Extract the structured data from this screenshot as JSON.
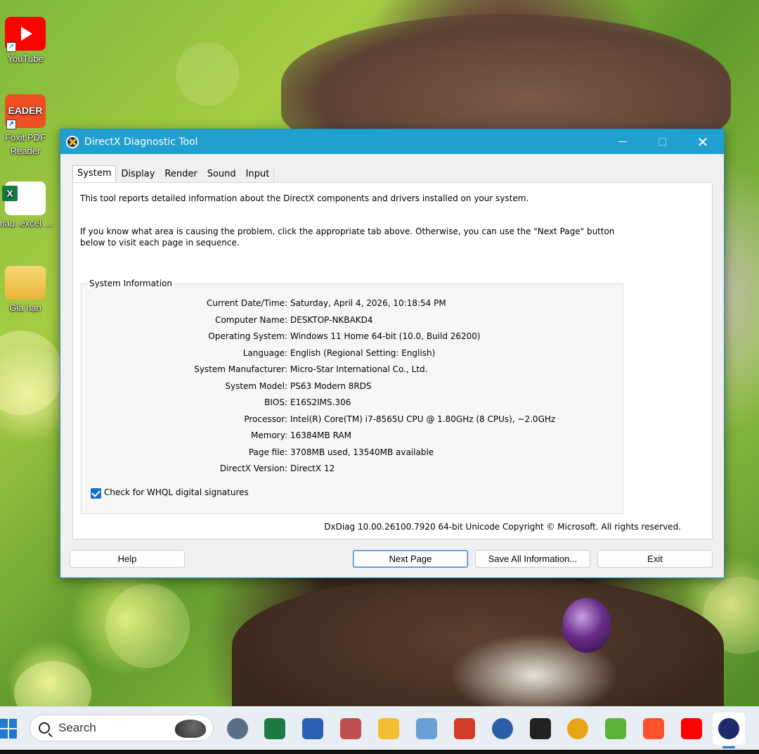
{
  "desktop": {
    "icons": [
      {
        "name": "youtube-shortcut",
        "label": "YouTube"
      },
      {
        "name": "foxit-shortcut",
        "label": "Foxit PDF Reader",
        "glyph_text": "EADER"
      },
      {
        "name": "excel-file",
        "label": "mau_excel_..."
      },
      {
        "name": "folder",
        "label": "Gia hạn"
      }
    ]
  },
  "window": {
    "title": "DirectX Diagnostic Tool",
    "controls": {
      "close": "✕"
    },
    "tabs": [
      "System",
      "Display",
      "Render",
      "Sound",
      "Input"
    ],
    "active_tab": "System",
    "intro1": "This tool reports detailed information about the DirectX components and drivers installed on your system.",
    "intro2": "If you know what area is causing the problem, click the appropriate tab above.  Otherwise, you can use the \"Next Page\" button below to visit each page in sequence.",
    "group_title": "System Information",
    "info": [
      {
        "label": "Current Date/Time:",
        "value": "Saturday, April 4, 2026, 10:18:54 PM"
      },
      {
        "label": "Computer Name:",
        "value": "DESKTOP-NKBAKD4"
      },
      {
        "label": "Operating System:",
        "value": "Windows 11 Home 64-bit (10.0, Build 26200)"
      },
      {
        "label": "Language:",
        "value": "English (Regional Setting: English)"
      },
      {
        "label": "System Manufacturer:",
        "value": "Micro-Star International Co., Ltd."
      },
      {
        "label": "System Model:",
        "value": "PS63 Modern 8RDS"
      },
      {
        "label": "BIOS:",
        "value": "E16S2IMS.306"
      },
      {
        "label": "Processor:",
        "value": "Intel(R) Core(TM) i7-8565U CPU @ 1.80GHz (8 CPUs), ~2.0GHz"
      },
      {
        "label": "Memory:",
        "value": "16384MB RAM"
      },
      {
        "label": "Page file:",
        "value": "3708MB used, 13540MB available"
      },
      {
        "label": "DirectX Version:",
        "value": "DirectX 12"
      }
    ],
    "whql_label": "Check for WHQL digital signatures",
    "whql_checked": true,
    "copyright": "DxDiag 10.00.26100.7920 64-bit Unicode  Copyright © Microsoft. All rights reserved.",
    "buttons": {
      "help": "Help",
      "next": "Next Page",
      "save": "Save All Information...",
      "exit": "Exit"
    }
  },
  "taskbar": {
    "search_placeholder": "Search",
    "apps": [
      {
        "name": "settings-icon",
        "color": "#5a6e86"
      },
      {
        "name": "excel-icon",
        "color": "#1d7a43"
      },
      {
        "name": "word-icon",
        "color": "#2b5fb4"
      },
      {
        "name": "snipping-icon",
        "color": "#c0504d"
      },
      {
        "name": "file-explorer-icon",
        "color": "#f2bf33"
      },
      {
        "name": "notepad-icon",
        "color": "#6aa0d8"
      },
      {
        "name": "calculator-icon",
        "color": "#d23a2a"
      },
      {
        "name": "browser-globe-icon",
        "color": "#2c5fa8"
      },
      {
        "name": "chatgpt-icon",
        "color": "#222222"
      },
      {
        "name": "chrome-icon",
        "color": "#e8a317"
      },
      {
        "name": "coccoc-icon",
        "color": "#5bb336"
      },
      {
        "name": "brave-icon",
        "color": "#fb542b"
      },
      {
        "name": "youtube-icon",
        "color": "#ff0000"
      },
      {
        "name": "directx-icon",
        "color": "#1d2a6b"
      }
    ]
  }
}
